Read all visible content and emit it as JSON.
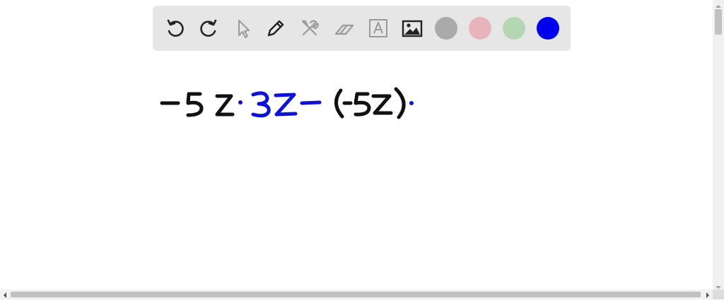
{
  "toolbar": {
    "tools": [
      {
        "id": "undo",
        "icon": "undo-icon"
      },
      {
        "id": "redo",
        "icon": "redo-icon"
      },
      {
        "id": "select",
        "icon": "pointer-icon"
      },
      {
        "id": "pen",
        "icon": "pen-icon"
      },
      {
        "id": "tools",
        "icon": "tools-icon"
      },
      {
        "id": "eraser",
        "icon": "eraser-icon"
      },
      {
        "id": "text",
        "icon": "text-box-icon"
      },
      {
        "id": "image",
        "icon": "image-icon"
      }
    ],
    "colors": [
      {
        "name": "gray",
        "hex": "#aaaaaa"
      },
      {
        "name": "pink",
        "hex": "#e8b4bc"
      },
      {
        "name": "green",
        "hex": "#b5d6b2"
      },
      {
        "name": "blue",
        "hex": "#0000ee"
      }
    ],
    "selected_color": "blue"
  },
  "canvas": {
    "handwriting": "−5z·3z−(−5z)·",
    "ink_colors": {
      "black": "#111111",
      "blue": "#0e12d6"
    }
  }
}
